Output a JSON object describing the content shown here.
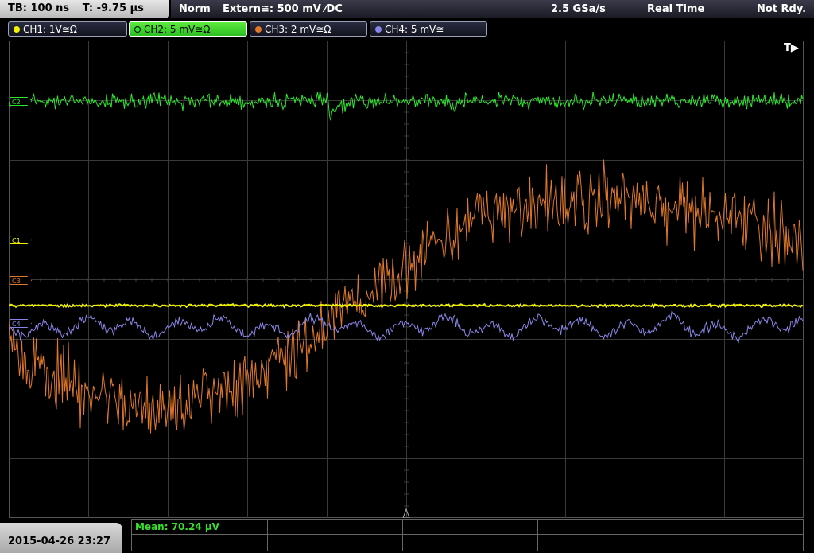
{
  "topbar": {
    "timebase": "TB: 100 ns",
    "trigger_time": "T: -9.75 µs",
    "mode": "Norm",
    "trigger_source": "Extern≅: 500 mV ⁄DC",
    "sample_rate": "2.5 GSa/s",
    "acquisition": "Real Time",
    "status": "Not Rdy."
  },
  "channels": [
    {
      "label": "CH1: 1V≅Ω",
      "color": "#f2f200",
      "active": false
    },
    {
      "label": "CH2: 5 mV≅Ω",
      "color": "#2ee62e",
      "active": true
    },
    {
      "label": "CH3: 2 mV≅Ω",
      "color": "#e0782a",
      "active": false
    },
    {
      "label": "CH4: 5 mV≅",
      "color": "#8a86e8",
      "active": false
    }
  ],
  "trigger_indicator": "T▶",
  "markers": {
    "c2": "C2",
    "c1": "C1",
    "c3": "C3",
    "c4": "C4"
  },
  "datetime": "2015-04-26 23:27",
  "measurement": {
    "mean": "Mean: 70.24 µV"
  },
  "colors": {
    "ch1": "#f2f200",
    "ch2": "#2ee62e",
    "ch3": "#e0782a",
    "ch4": "#8a86e8",
    "grid": "#3a3a3a"
  }
}
